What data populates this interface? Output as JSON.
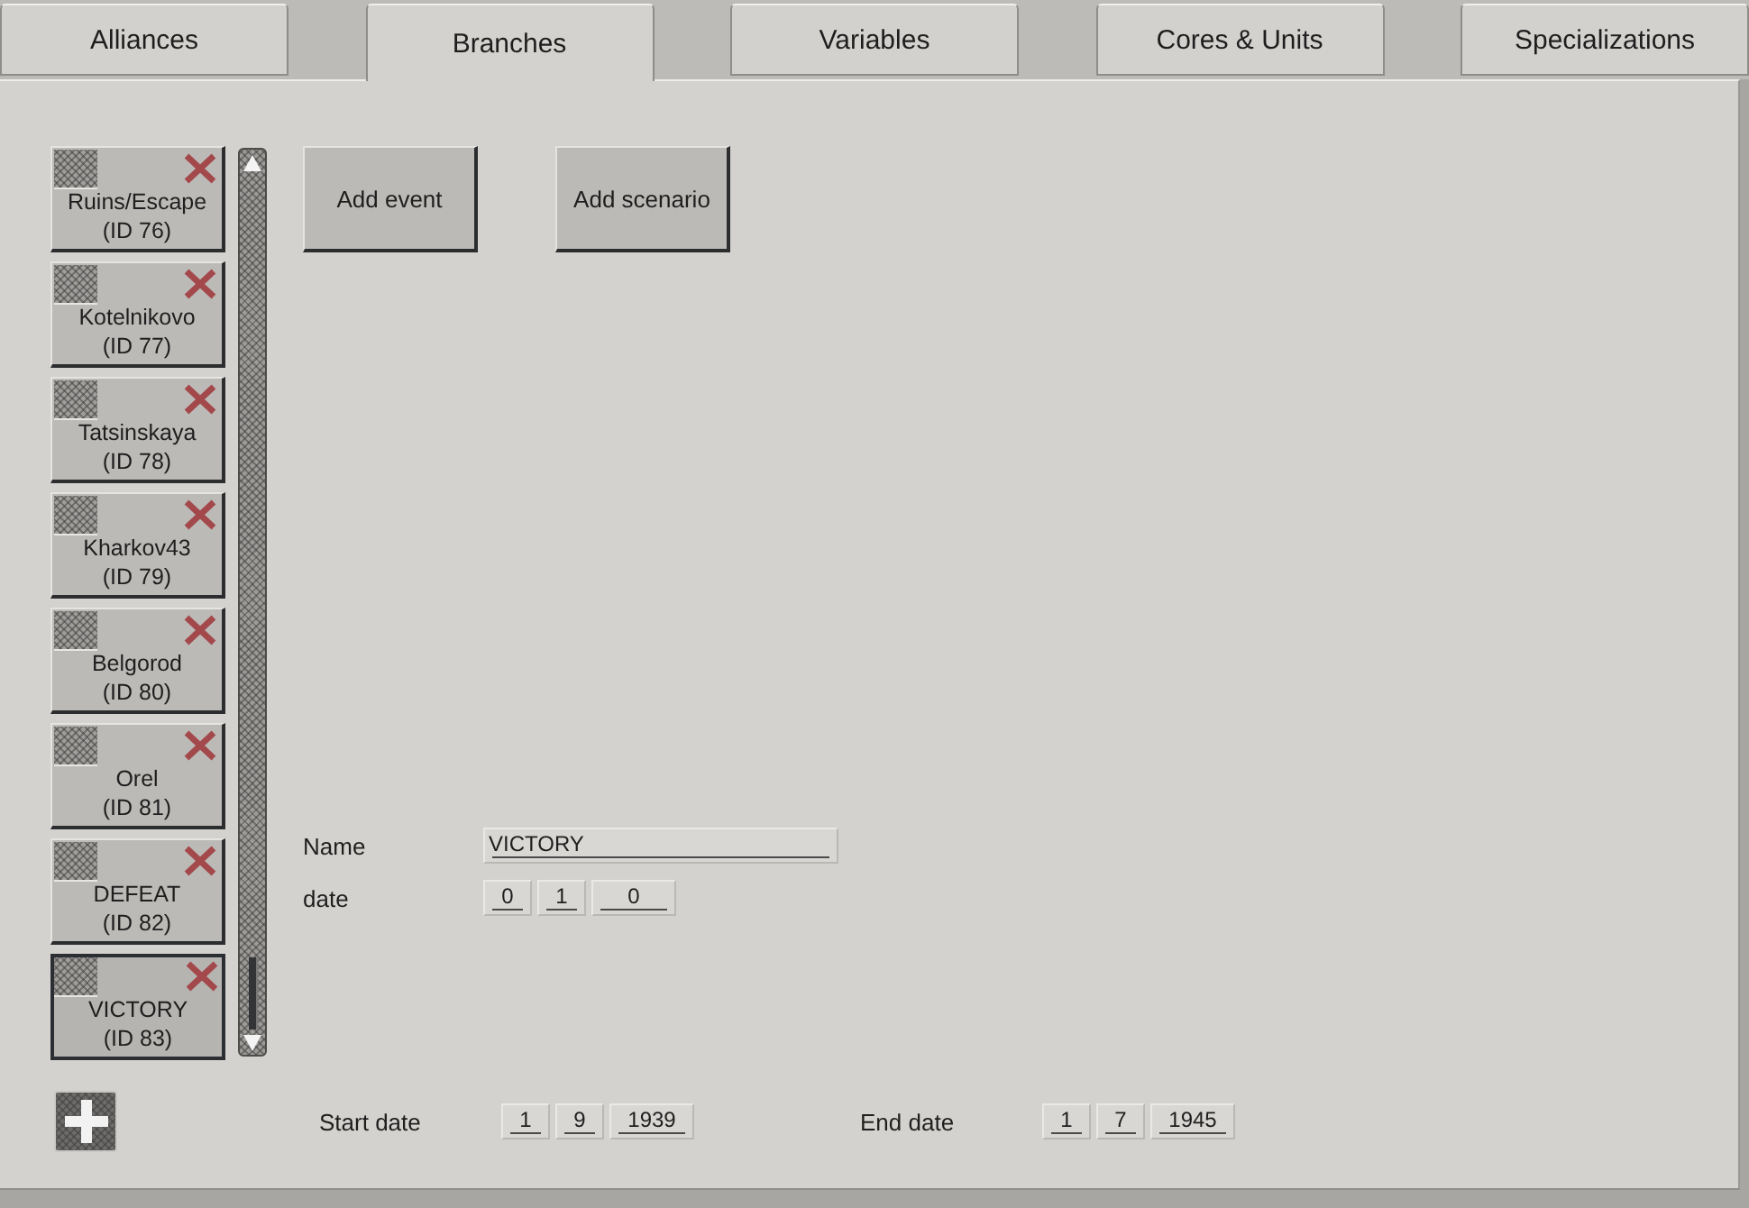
{
  "tabs": [
    {
      "label": "Alliances",
      "selected": false
    },
    {
      "label": "Branches",
      "selected": true
    },
    {
      "label": "Variables",
      "selected": false
    },
    {
      "label": "Cores & Units",
      "selected": false
    },
    {
      "label": "Specializations",
      "selected": false
    }
  ],
  "branches": [
    {
      "name": "Ruins/Escape",
      "id_label": "(ID 76)",
      "selected": false
    },
    {
      "name": "Kotelnikovo",
      "id_label": "(ID 77)",
      "selected": false
    },
    {
      "name": "Tatsinskaya",
      "id_label": "(ID 78)",
      "selected": false
    },
    {
      "name": "Kharkov43",
      "id_label": "(ID 79)",
      "selected": false
    },
    {
      "name": "Belgorod",
      "id_label": "(ID 80)",
      "selected": false
    },
    {
      "name": "Orel",
      "id_label": "(ID 81)",
      "selected": false
    },
    {
      "name": "DEFEAT",
      "id_label": "(ID 82)",
      "selected": false
    },
    {
      "name": "VICTORY",
      "id_label": "(ID 83)",
      "selected": true
    }
  ],
  "actions": [
    {
      "label": "Add event"
    },
    {
      "label": "Add scenario"
    }
  ],
  "branch_details": {
    "fields": [
      {
        "kind": "text",
        "label": "Name",
        "value": "VICTORY"
      },
      {
        "kind": "date",
        "label": "date",
        "values": [
          "0",
          "1",
          "0"
        ]
      }
    ]
  },
  "campaign_dates": [
    {
      "label": "Start date",
      "values": [
        "1",
        "9",
        "1939"
      ]
    },
    {
      "label": "End date",
      "values": [
        "1",
        "7",
        "1945"
      ]
    }
  ]
}
